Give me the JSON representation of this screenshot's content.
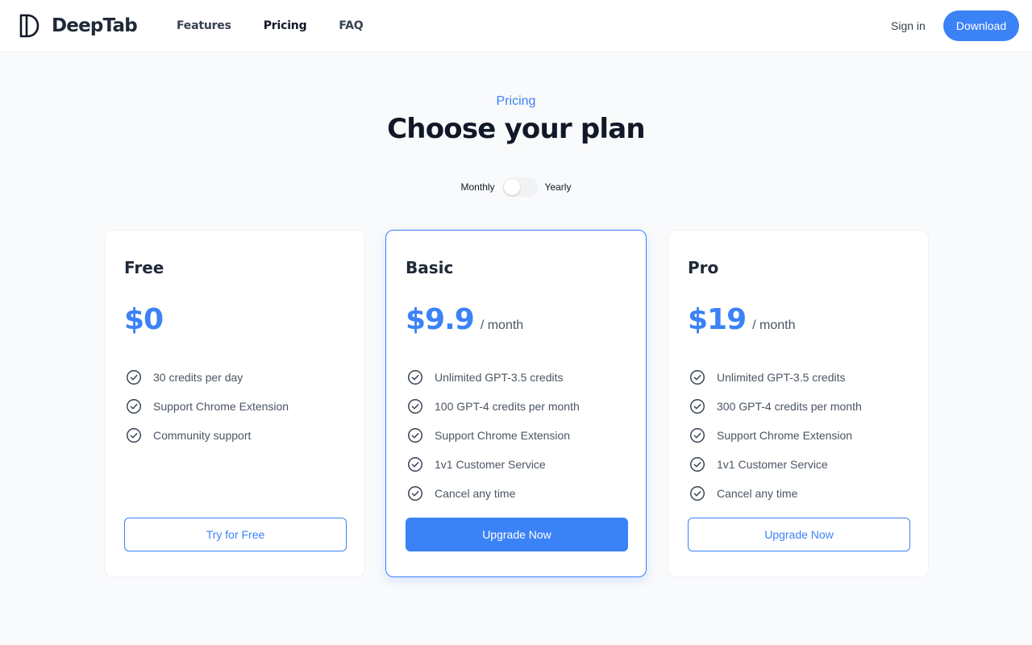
{
  "header": {
    "brand": "DeepTab",
    "nav": [
      {
        "label": "Features",
        "active": false
      },
      {
        "label": "Pricing",
        "active": true
      },
      {
        "label": "FAQ",
        "active": false
      }
    ],
    "signin_label": "Sign in",
    "download_label": "Download"
  },
  "hero": {
    "eyebrow": "Pricing",
    "title": "Choose your plan"
  },
  "billing": {
    "monthly_label": "Monthly",
    "yearly_label": "Yearly",
    "selected": "Monthly"
  },
  "plans": [
    {
      "name": "Free",
      "price": "$0",
      "period": "",
      "features": [
        "30 credits per day",
        "Support Chrome Extension",
        "Community support"
      ],
      "cta": "Try for Free",
      "highlighted": false
    },
    {
      "name": "Basic",
      "price": "$9.9",
      "period": "/ month",
      "features": [
        "Unlimited GPT-3.5 credits",
        "100 GPT-4 credits per month",
        "Support Chrome Extension",
        "1v1 Customer Service",
        "Cancel any time"
      ],
      "cta": "Upgrade Now",
      "highlighted": true
    },
    {
      "name": "Pro",
      "price": "$19",
      "period": "/ month",
      "features": [
        "Unlimited GPT-3.5 credits",
        "300 GPT-4 credits per month",
        "Support Chrome Extension",
        "1v1 Customer Service",
        "Cancel any time"
      ],
      "cta": "Upgrade Now",
      "highlighted": false
    }
  ],
  "colors": {
    "accent": "#3b82f6",
    "text": "#1f2937",
    "muted": "#4b5563",
    "background": "#f9fafb"
  }
}
